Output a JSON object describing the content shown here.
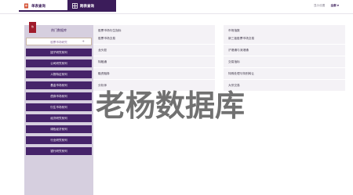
{
  "header": {
    "tabs": [
      {
        "label": "单表查询",
        "active": true
      },
      {
        "label": "跨表查询",
        "active": false
      }
    ],
    "links": {
      "display": "显示设置",
      "language": "全部"
    }
  },
  "sidebar": {
    "hot_label": "热门数据库",
    "hot_badge": "热",
    "items": [
      {
        "label": "股票市场研究",
        "active": true
      },
      {
        "label": "因子研究系列"
      },
      {
        "label": "公司研究系列"
      },
      {
        "label": "人物特征系列"
      },
      {
        "label": "基金市场系列"
      },
      {
        "label": "债券市场系列"
      },
      {
        "label": "衍生市场系列"
      },
      {
        "label": "经济研究系列"
      },
      {
        "label": "绿色经济系列"
      },
      {
        "label": "行业研究系列"
      },
      {
        "label": "银行研究系列"
      }
    ]
  },
  "metrics": {
    "left": [
      "股票市场衍生指标",
      "股票市场交易",
      "龙头股",
      "特融通",
      "融资融券",
      "分析师"
    ],
    "right": [
      "市场指数",
      "新三板股票市场交易",
      "沪港通与深港通",
      "交易指标",
      "特殊处理与特别转让",
      "大宗交易"
    ]
  },
  "watermark": "老杨数据库",
  "colors": {
    "brand": "#3b1c5a",
    "sidebar_item": "#46246a",
    "sidebar_bg": "#d6cfdf",
    "badge": "#a01c2c"
  }
}
